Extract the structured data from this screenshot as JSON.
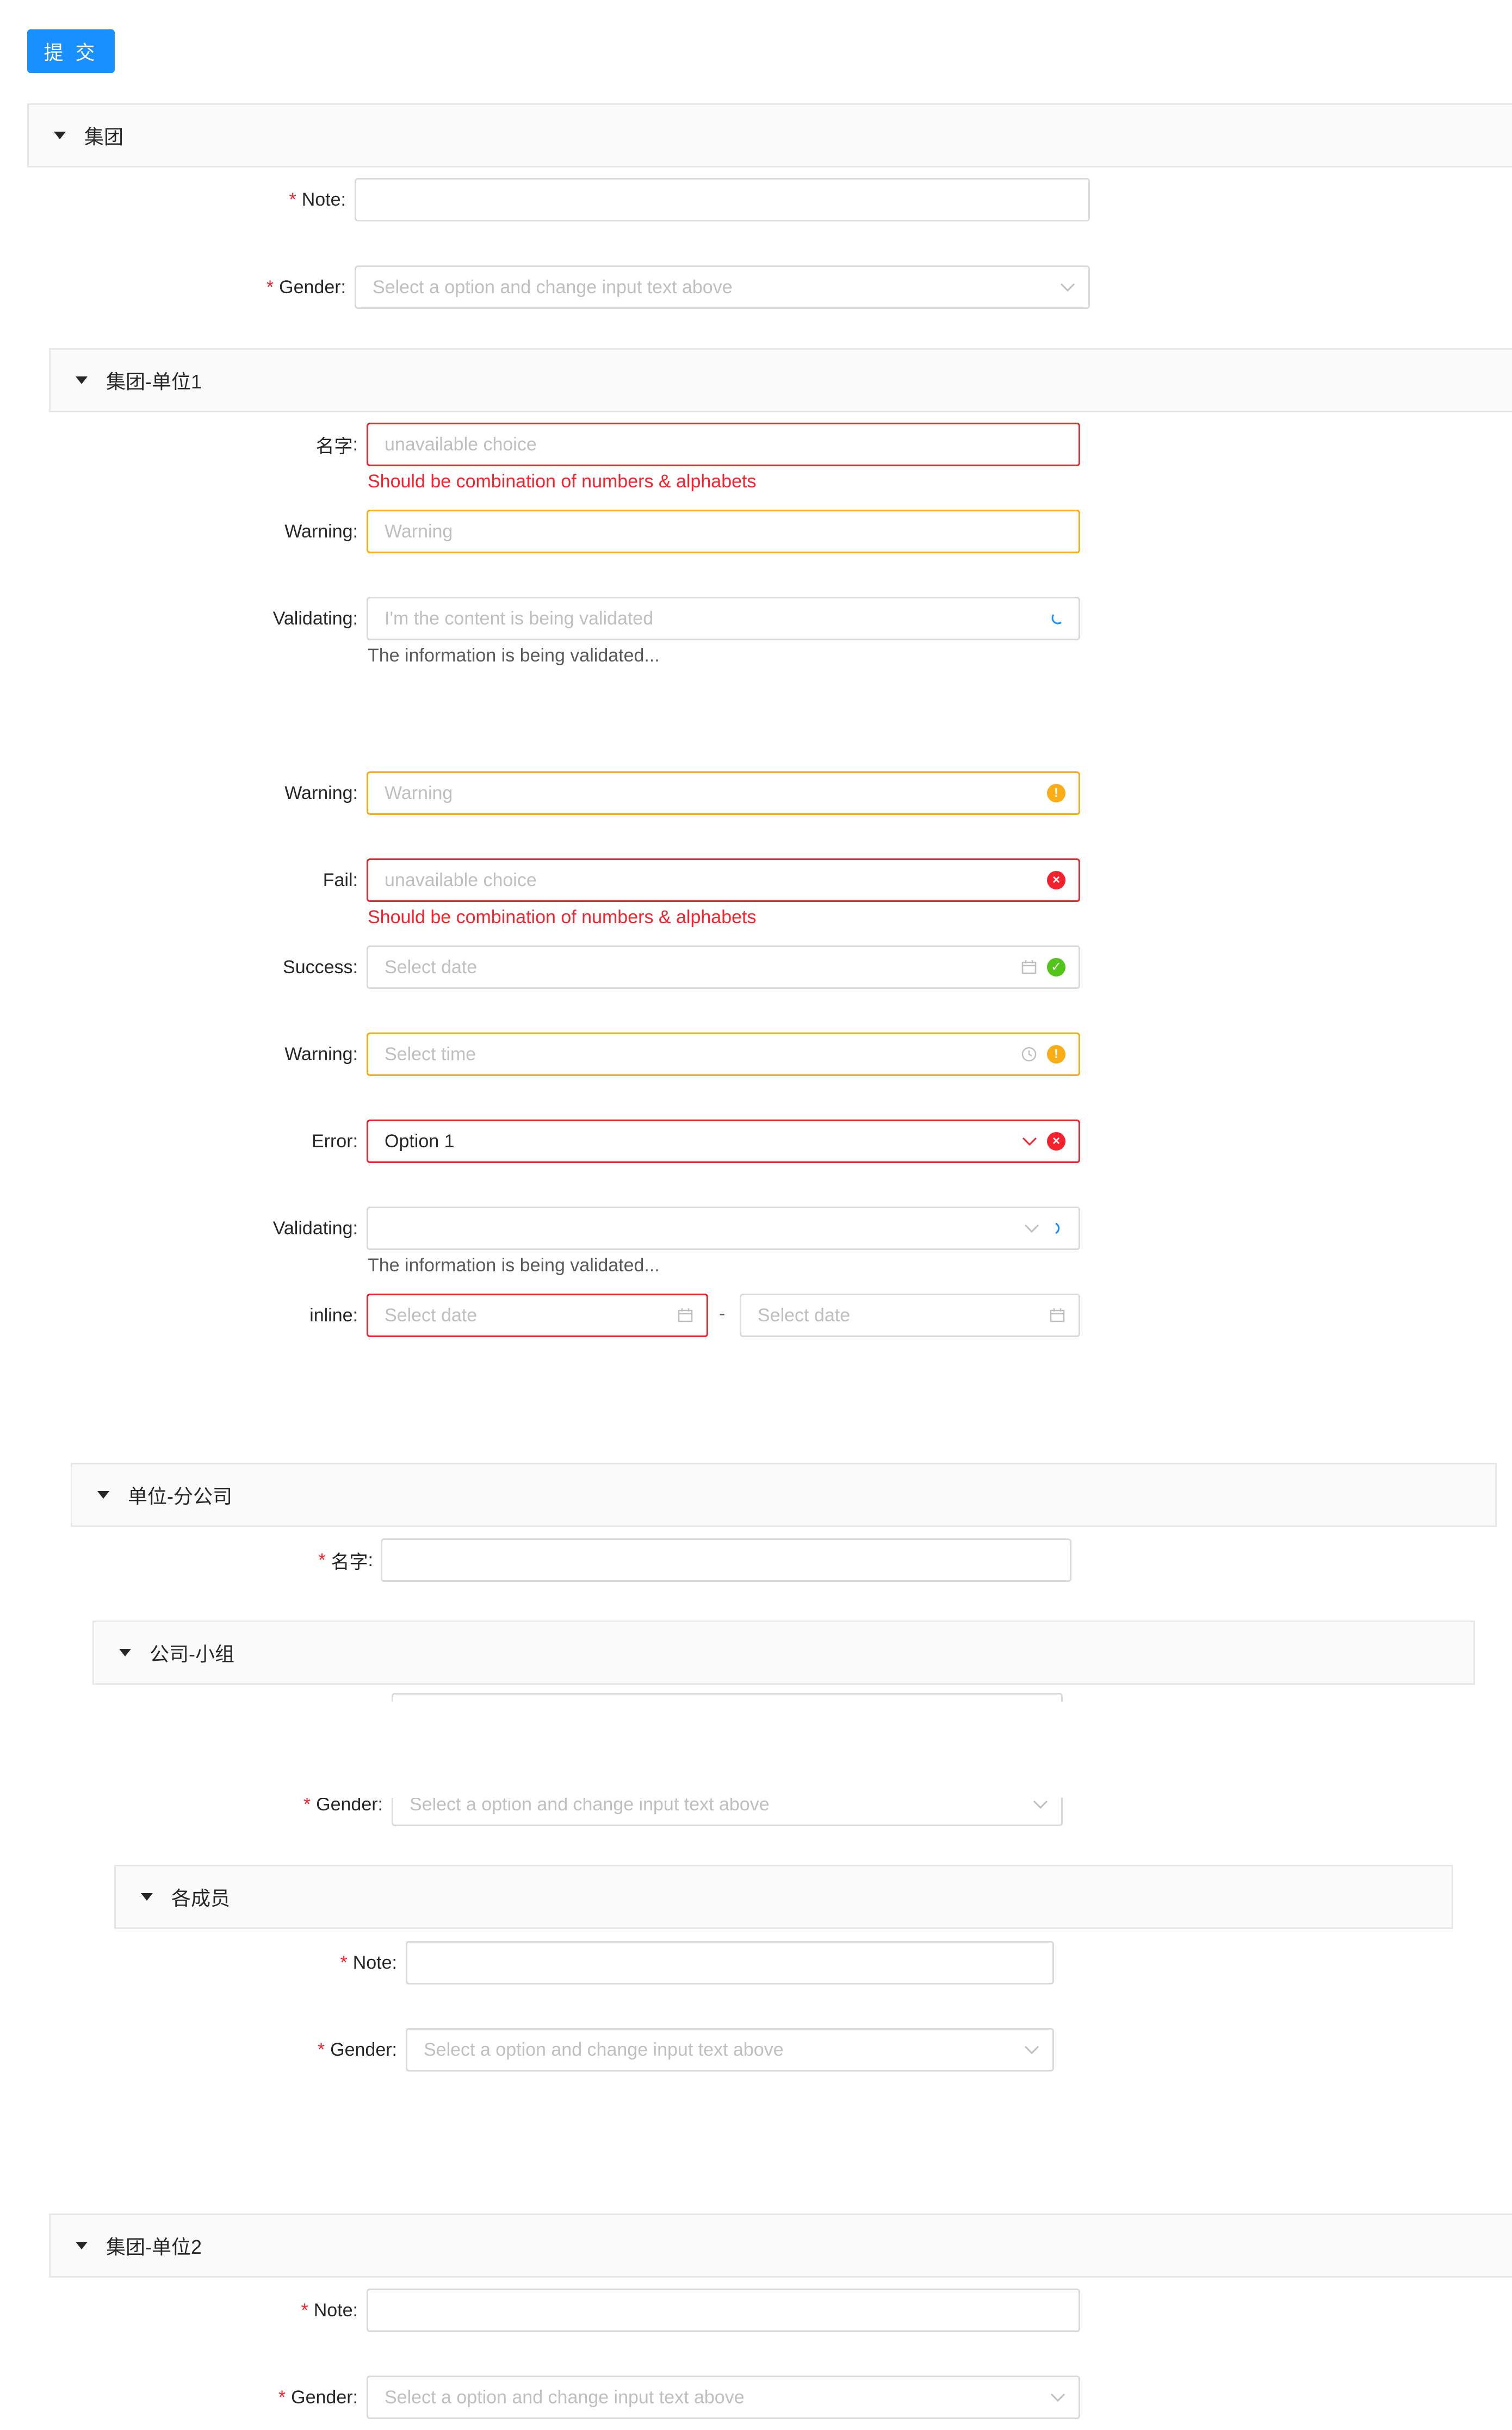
{
  "submit_label": "提 交",
  "sections": {
    "group": "集团",
    "unit1": "集团-单位1",
    "branch": "单位-分公司",
    "team": "公司-小组",
    "members": "各成员",
    "unit2": "集团-单位2"
  },
  "labels": {
    "note": "Note",
    "gender": "Gender",
    "name_cn": "名字",
    "warning": "Warning",
    "validating": "Validating",
    "fail": "Fail",
    "success": "Success",
    "error": "Error",
    "inline": "inline",
    "colon": ":",
    "required_mark": "*"
  },
  "placeholders": {
    "gender_select": "Select a option and change input text above",
    "unavailable": "unavailable choice",
    "warning": "Warning",
    "validating": "I'm the content is being validated",
    "select_date": "Select date",
    "select_time": "Select time"
  },
  "values": {
    "error_select": "Option 1"
  },
  "messages": {
    "combination": "Should be combination of numbers & alphabets",
    "validating_info": "The information is being validated...",
    "range_separator": "-"
  },
  "icons": {
    "section_toggle": "caret-down-icon",
    "select_arrow": "chevron-down-icon",
    "date": "calendar-icon",
    "time": "clock-icon",
    "loading": "loading-icon",
    "warning_status": "exclamation-circle-icon",
    "error_status": "close-circle-icon",
    "success_status": "check-circle-icon"
  },
  "colors": {
    "primary": "#1890ff",
    "error": "#f5222d",
    "warning": "#faad14",
    "success": "#52c41a",
    "border": "#d9d9d9",
    "header_bg": "#fafafa"
  }
}
